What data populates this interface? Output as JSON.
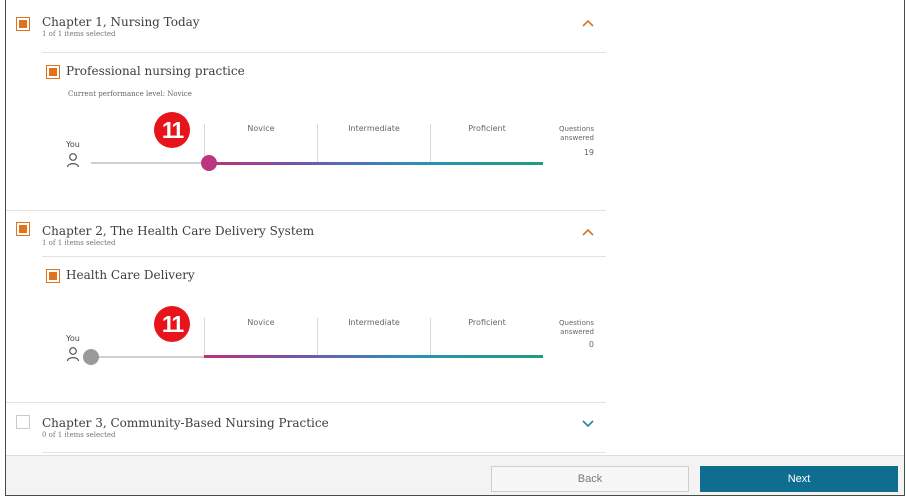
{
  "colors": {
    "accent_orange": "#e0731d",
    "primary_button": "#0f6e90",
    "badge_red": "#e8141c",
    "knob_active": "#b8377f",
    "knob_inactive": "#9a9a9a"
  },
  "chapters": [
    {
      "title": "Chapter 1, Nursing Today",
      "subtitle": "1 of 1 items selected",
      "checked": true,
      "expanded": true,
      "chevron": "chevron-up-icon",
      "topic": {
        "title": "Professional nursing practice",
        "performance": "Current performance level: Novice",
        "badge": "11",
        "levels": [
          "Novice",
          "Intermediate",
          "Proficient"
        ],
        "you_label": "You",
        "questions_label_1": "Questions",
        "questions_label_2": "answered",
        "questions_answered": "19"
      }
    },
    {
      "title": "Chapter 2, The Health Care Delivery System",
      "subtitle": "1 of 1 items selected",
      "checked": true,
      "expanded": true,
      "chevron": "chevron-up-icon",
      "topic": {
        "title": "Health Care Delivery",
        "badge": "11",
        "levels": [
          "Novice",
          "Intermediate",
          "Proficient"
        ],
        "you_label": "You",
        "questions_label_1": "Questions",
        "questions_label_2": "answered",
        "questions_answered": "0"
      }
    },
    {
      "title": "Chapter 3, Community-Based Nursing Practice",
      "subtitle": "0 of 1 items selected",
      "checked": false,
      "expanded": false,
      "chevron": "chevron-down-icon"
    }
  ],
  "footer": {
    "back_label": "Back",
    "next_label": "Next"
  }
}
